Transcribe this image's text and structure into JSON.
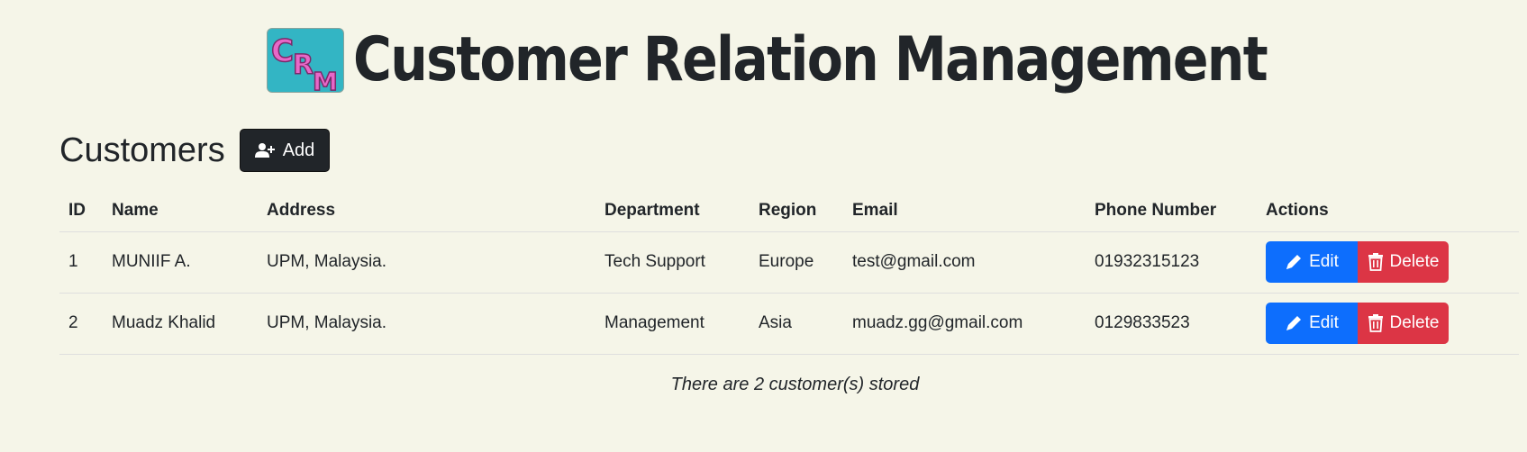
{
  "header": {
    "logo_text": "CRM",
    "title": "Customer Relation Management"
  },
  "section": {
    "title": "Customers",
    "add_label": "Add"
  },
  "table": {
    "columns": [
      "ID",
      "Name",
      "Address",
      "Department",
      "Region",
      "Email",
      "Phone Number",
      "Actions"
    ],
    "rows": [
      {
        "id": "1",
        "name": "MUNIIF A.",
        "address": "UPM, Malaysia.",
        "department": "Tech Support",
        "region": "Europe",
        "email": "test@gmail.com",
        "phone": "01932315123"
      },
      {
        "id": "2",
        "name": "Muadz Khalid",
        "address": "UPM, Malaysia.",
        "department": "Management",
        "region": "Asia",
        "email": "muadz.gg@gmail.com",
        "phone": "0129833523"
      }
    ],
    "edit_label": "Edit",
    "delete_label": "Delete"
  },
  "footer": {
    "note": "There are 2 customer(s) stored"
  },
  "colors": {
    "background": "#f5f5e8",
    "edit": "#0d6efd",
    "delete": "#dc3545",
    "dark": "#212529",
    "logo_bg": "#33b5c4",
    "logo_text": "#e868c8"
  }
}
